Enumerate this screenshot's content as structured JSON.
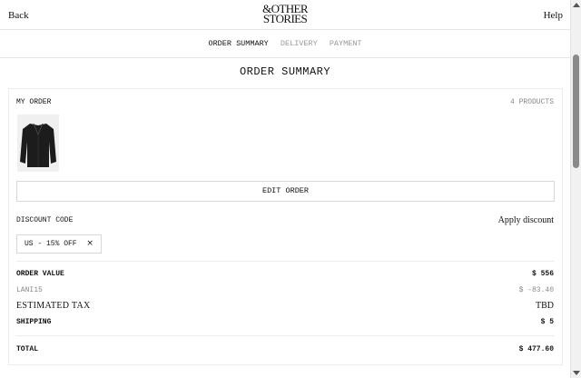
{
  "header": {
    "back_label": "Back",
    "help_label": "Help",
    "logo_line1": "&OTHER",
    "logo_line2": "STORIES"
  },
  "steps": [
    {
      "label": "ORDER SUMMARY",
      "active": true
    },
    {
      "label": "DELIVERY",
      "active": false
    },
    {
      "label": "PAYMENT",
      "active": false
    }
  ],
  "page_title": "ORDER SUMMARY",
  "my_order": {
    "label": "MY ORDER",
    "count": "4 PRODUCTS",
    "edit_label": "EDIT ORDER"
  },
  "discount": {
    "label": "DISCOUNT CODE",
    "apply_label": "Apply discount",
    "chip_label": "US - 15% OFF",
    "chip_close": "×"
  },
  "summary": {
    "order_value_label": "ORDER VALUE",
    "order_value": "$ 556",
    "code_label": "LANI15",
    "code_value": "$ -83.40",
    "tax_label": "ESTIMATED TAX",
    "tax_value": "TBD",
    "shipping_label": "SHIPPING",
    "shipping_value": "$ 5",
    "total_label": "TOTAL",
    "total_value": "$ 477.60"
  },
  "colors": {
    "text": "#111111",
    "muted": "#888888",
    "border": "#e6e6e6"
  }
}
